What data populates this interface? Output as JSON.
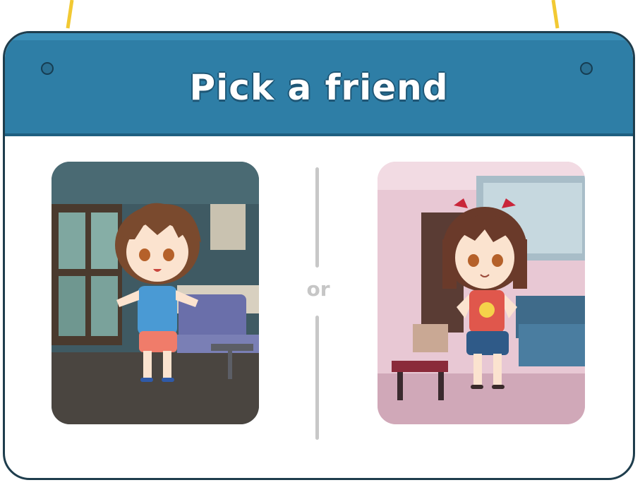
{
  "title": "Pick a friend",
  "divider_text": "or",
  "choices": [
    {
      "id": "boy",
      "icon": "boy-character-icon"
    },
    {
      "id": "girl",
      "icon": "girl-character-icon"
    }
  ],
  "colors": {
    "header": "#2e7ea6",
    "border": "#1e3d4d",
    "rope": "#f2c933",
    "divider": "#c8c8c8"
  }
}
